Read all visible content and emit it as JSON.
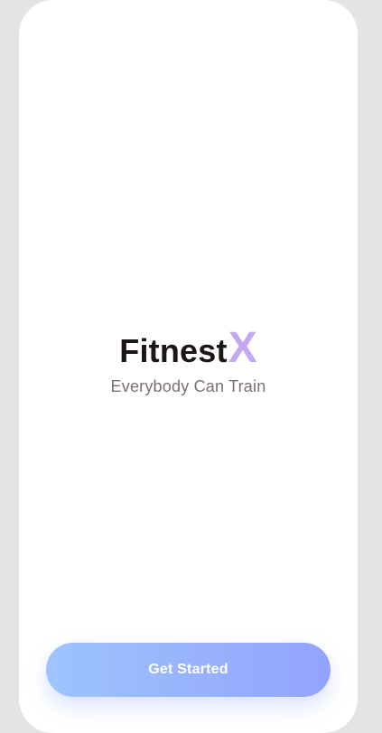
{
  "brand": {
    "name": "Fitnest",
    "mark": "X",
    "tagline": "Everybody Can Train"
  },
  "actions": {
    "get_started_label": "Get Started"
  },
  "colors": {
    "background": "#e4e4e4",
    "screen": "#ffffff",
    "logo_text": "#1d1617",
    "logo_accent": "#c3a7f1",
    "tagline": "#7b6f72",
    "button_gradient_start": "#9ec4fd",
    "button_gradient_end": "#92a3fd",
    "button_text": "#ffffff"
  }
}
